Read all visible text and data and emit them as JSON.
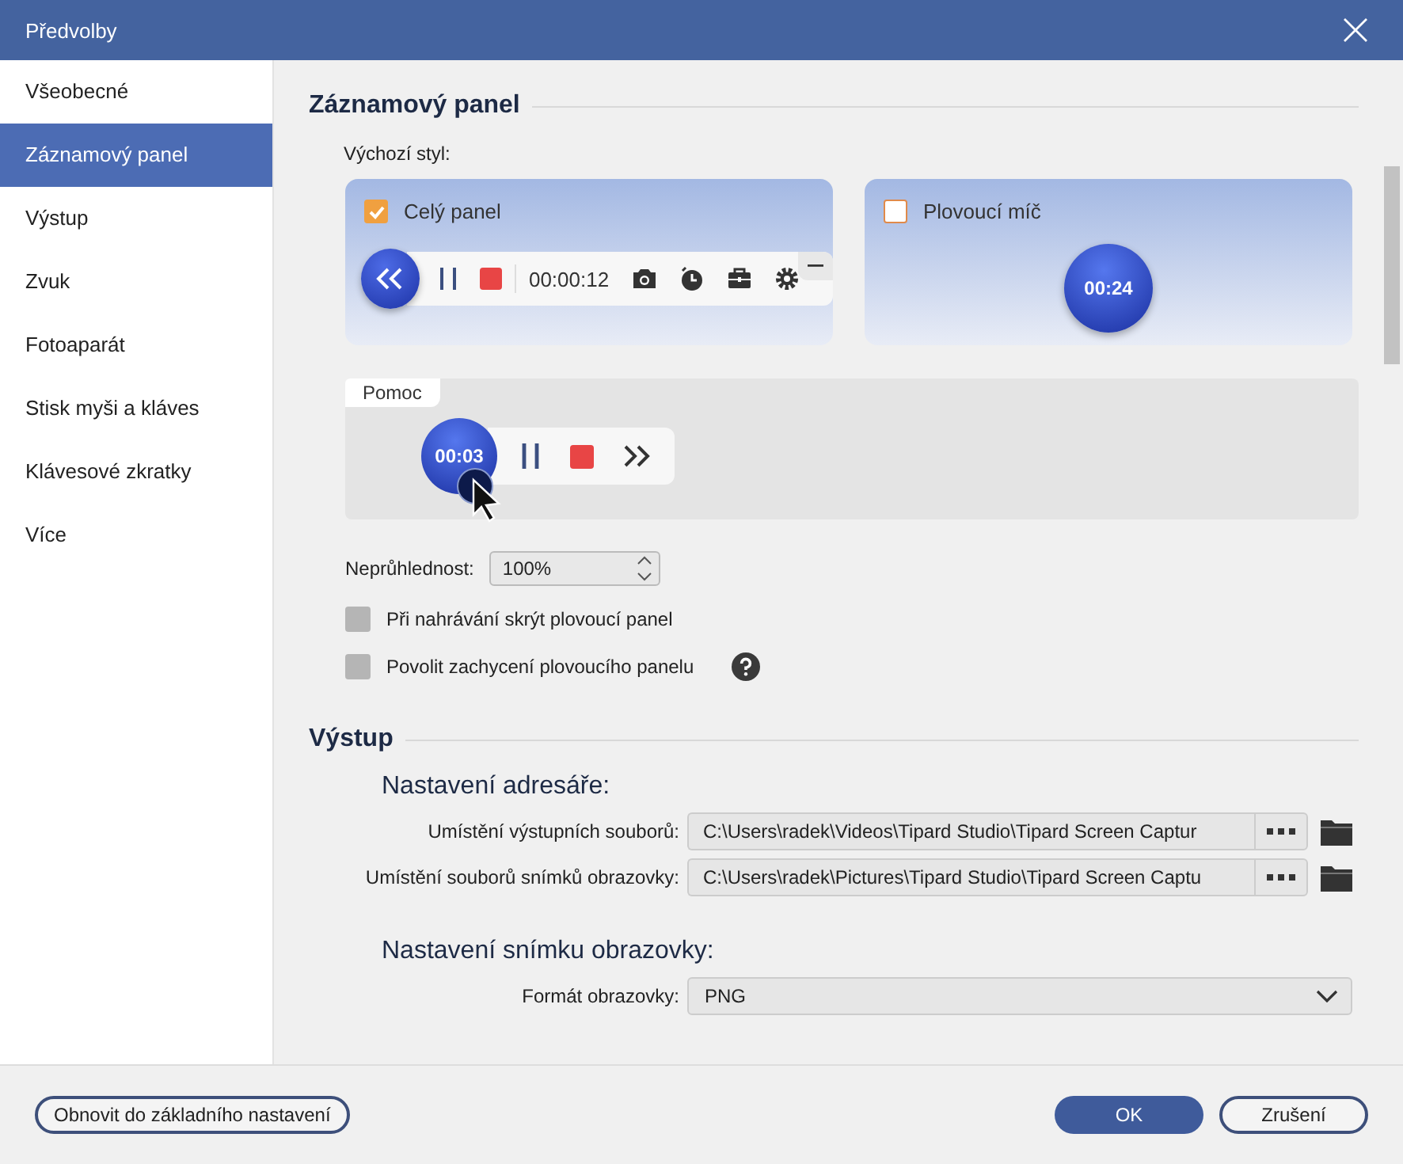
{
  "window": {
    "title": "Předvolby"
  },
  "sidebar": {
    "items": [
      {
        "label": "Všeobecné",
        "selected": false
      },
      {
        "label": "Záznamový panel",
        "selected": true
      },
      {
        "label": "Výstup",
        "selected": false
      },
      {
        "label": "Zvuk",
        "selected": false
      },
      {
        "label": "Fotoaparát",
        "selected": false
      },
      {
        "label": "Stisk myši a kláves",
        "selected": false
      },
      {
        "label": "Klávesové zkratky",
        "selected": false
      },
      {
        "label": "Více",
        "selected": false
      }
    ]
  },
  "recorder": {
    "title": "Záznamový panel",
    "style_label": "Výchozí styl:",
    "styles": [
      {
        "kind": "full",
        "label": "Celý panel",
        "checked": true,
        "time": "00:00:12"
      },
      {
        "kind": "ball",
        "label": "Plovoucí míč",
        "checked": false,
        "time": "00:24"
      }
    ],
    "help": {
      "tab": "Pomoc",
      "time": "00:03"
    },
    "opacity": {
      "label": "Neprůhlednost:",
      "value": "100%"
    },
    "options": [
      {
        "label": "Při nahrávání skrýt plovoucí panel",
        "checked": false,
        "help": false
      },
      {
        "label": "Povolit zachycení plovoucího panelu",
        "checked": false,
        "help": true
      }
    ]
  },
  "output": {
    "title": "Výstup",
    "dir_heading": "Nastavení adresáře:",
    "paths": [
      {
        "label": "Umístění výstupních souborů:",
        "value": "C:\\Users\\radek\\Videos\\Tipard Studio\\Tipard Screen Captur"
      },
      {
        "label": "Umístění souborů snímků obrazovky:",
        "value": "C:\\Users\\radek\\Pictures\\Tipard Studio\\Tipard Screen Captu"
      }
    ],
    "shot_heading": "Nastavení snímku obrazovky:",
    "format": {
      "label": "Formát obrazovky:",
      "value": "PNG"
    }
  },
  "footer": {
    "reset": "Obnovit do základního nastavení",
    "ok": "OK",
    "cancel": "Zrušení"
  }
}
